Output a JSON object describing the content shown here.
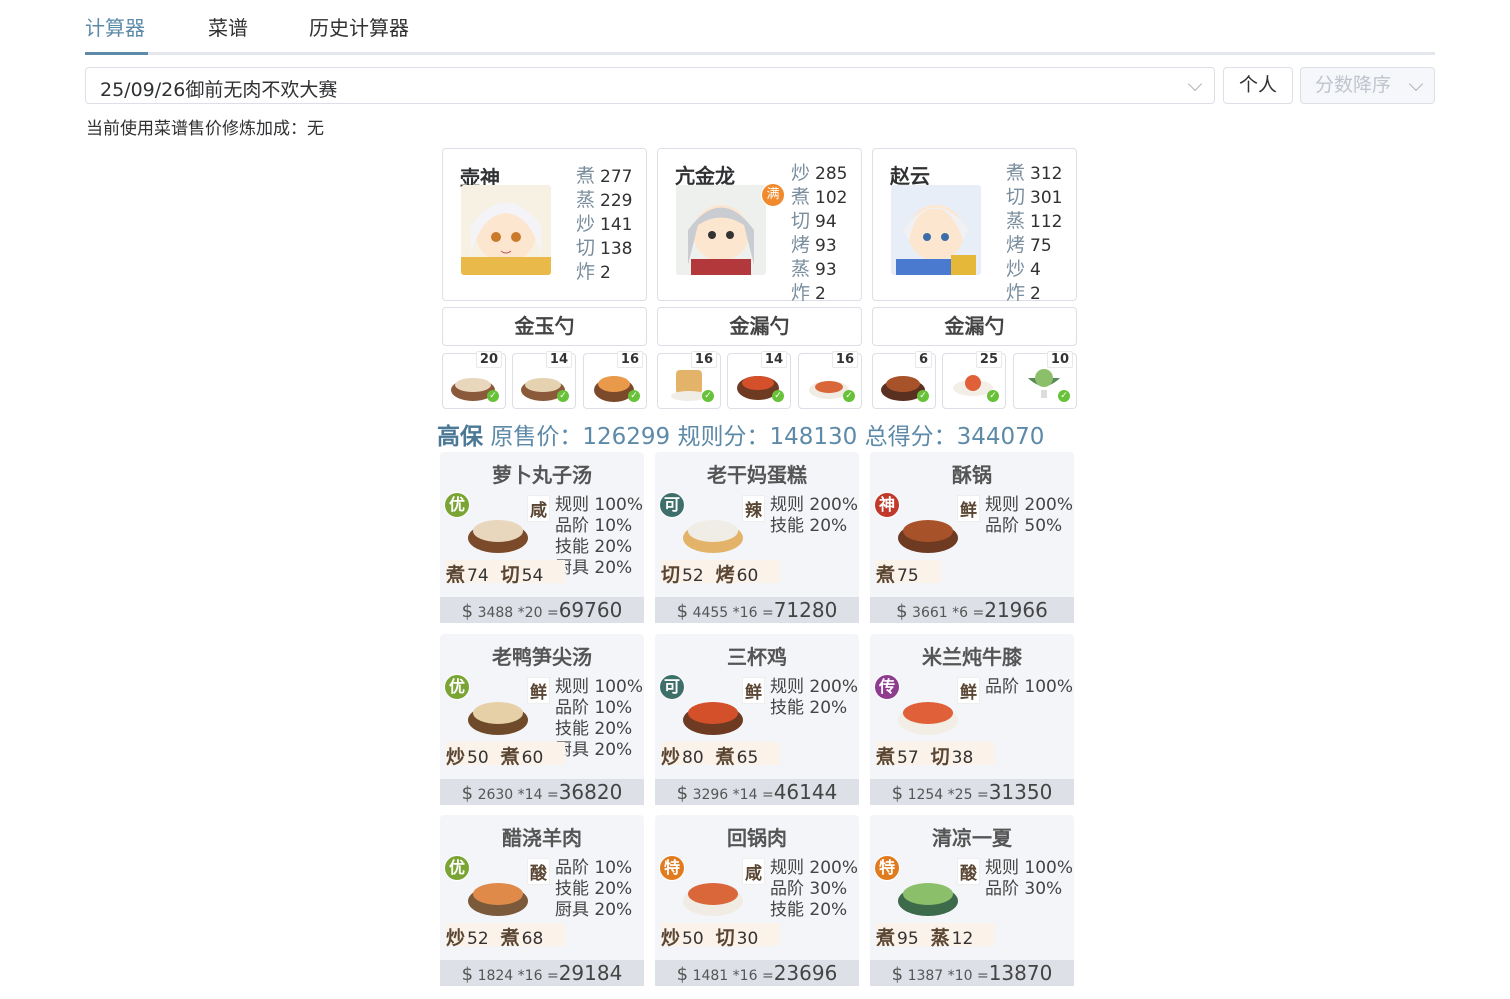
{
  "tabs": [
    {
      "label": "计算器"
    },
    {
      "label": "菜谱"
    },
    {
      "label": "历史计算器"
    }
  ],
  "contest_select": {
    "value": "25/09/26御前无肉不欢大赛"
  },
  "mode_button": "个人",
  "sort_select": {
    "value": "分数降序"
  },
  "note": "当前使用菜谱售价修炼加成：无",
  "chefs": [
    {
      "name": "壶神",
      "skills": [
        {
          "k": "煮",
          "v": "277"
        },
        {
          "k": "蒸",
          "v": "229"
        },
        {
          "k": "炒",
          "v": "141"
        },
        {
          "k": "切",
          "v": "138"
        },
        {
          "k": "炸",
          "v": "2"
        }
      ]
    },
    {
      "name": "亢金龙",
      "badge": "满",
      "skills": [
        {
          "k": "炒",
          "v": "285"
        },
        {
          "k": "煮",
          "v": "102"
        },
        {
          "k": "切",
          "v": "94"
        },
        {
          "k": "烤",
          "v": "93"
        },
        {
          "k": "蒸",
          "v": "93"
        },
        {
          "k": "炸",
          "v": "2"
        }
      ]
    },
    {
      "name": "赵云",
      "skills": [
        {
          "k": "煮",
          "v": "312"
        },
        {
          "k": "切",
          "v": "301"
        },
        {
          "k": "蒸",
          "v": "112"
        },
        {
          "k": "烤",
          "v": "75"
        },
        {
          "k": "炒",
          "v": "4"
        },
        {
          "k": "炸",
          "v": "2"
        }
      ]
    }
  ],
  "equips": [
    "金玉勺",
    "金漏勺",
    "金漏勺"
  ],
  "recipe_slots": [
    "20",
    "14",
    "16",
    "16",
    "14",
    "16",
    "6",
    "25",
    "10"
  ],
  "summary": {
    "tag": "高保",
    "orig_label": "原售价：",
    "orig": "126299",
    "rule_label": "规则分：",
    "rule": "148130",
    "total_label": "总得分：",
    "total": "344070"
  },
  "cards": [
    {
      "title": "萝卜丸子汤",
      "rank": "优",
      "rank_color": "#7aa534",
      "flavor": "咸",
      "effects": [
        "规则 100%",
        "品阶 10%",
        "技能 20%",
        "厨具 20%"
      ],
      "needs": [
        {
          "k": "煮",
          "v": "74"
        },
        {
          "k": "切",
          "v": "54"
        }
      ],
      "price": "3488",
      "mult": "*20",
      "total": "69760"
    },
    {
      "title": "老干妈蛋糕",
      "rank": "可",
      "rank_color": "#3e6f6a",
      "flavor": "辣",
      "effects": [
        "规则 200%",
        "技能 20%"
      ],
      "needs": [
        {
          "k": "切",
          "v": "52"
        },
        {
          "k": "烤",
          "v": "60"
        }
      ],
      "price": "4455",
      "mult": "*16",
      "total": "71280"
    },
    {
      "title": "酥锅",
      "rank": "神",
      "rank_color": "#c0392b",
      "flavor": "鲜",
      "effects": [
        "规则 200%",
        "品阶 50%"
      ],
      "needs": [
        {
          "k": "煮",
          "v": "75"
        }
      ],
      "price": "3661",
      "mult": "*6",
      "total": "21966"
    },
    {
      "title": "老鸭笋尖汤",
      "rank": "优",
      "rank_color": "#7aa534",
      "flavor": "鲜",
      "effects": [
        "规则 100%",
        "品阶 10%",
        "技能 20%",
        "厨具 20%"
      ],
      "needs": [
        {
          "k": "炒",
          "v": "50"
        },
        {
          "k": "煮",
          "v": "60"
        }
      ],
      "price": "2630",
      "mult": "*14",
      "total": "36820"
    },
    {
      "title": "三杯鸡",
      "rank": "可",
      "rank_color": "#3e6f6a",
      "flavor": "鲜",
      "effects": [
        "规则 200%",
        "技能 20%"
      ],
      "needs": [
        {
          "k": "炒",
          "v": "80"
        },
        {
          "k": "煮",
          "v": "65"
        }
      ],
      "price": "3296",
      "mult": "*14",
      "total": "46144"
    },
    {
      "title": "米兰炖牛膝",
      "rank": "传",
      "rank_color": "#8e3c8e",
      "flavor": "鲜",
      "effects": [
        "品阶 100%"
      ],
      "needs": [
        {
          "k": "煮",
          "v": "57"
        },
        {
          "k": "切",
          "v": "38"
        }
      ],
      "price": "1254",
      "mult": "*25",
      "total": "31350"
    },
    {
      "title": "醋浇羊肉",
      "rank": "优",
      "rank_color": "#7aa534",
      "flavor": "酸",
      "effects": [
        "品阶 10%",
        "技能 20%",
        "厨具 20%"
      ],
      "needs": [
        {
          "k": "炒",
          "v": "52"
        },
        {
          "k": "煮",
          "v": "68"
        }
      ],
      "price": "1824",
      "mult": "*16",
      "total": "29184"
    },
    {
      "title": "回锅肉",
      "rank": "特",
      "rank_color": "#e07b1f",
      "flavor": "咸",
      "effects": [
        "规则 200%",
        "品阶 30%",
        "技能 20%"
      ],
      "needs": [
        {
          "k": "炒",
          "v": "50"
        },
        {
          "k": "切",
          "v": "30"
        }
      ],
      "price": "1481",
      "mult": "*16",
      "total": "23696"
    },
    {
      "title": "清凉一夏",
      "rank": "特",
      "rank_color": "#e07b1f",
      "flavor": "酸",
      "effects": [
        "规则 100%",
        "品阶 30%"
      ],
      "needs": [
        {
          "k": "煮",
          "v": "95"
        },
        {
          "k": "蒸",
          "v": "12"
        }
      ],
      "price": "1387",
      "mult": "*10",
      "total": "13870"
    }
  ],
  "currency_symbol": "$",
  "equals": "="
}
